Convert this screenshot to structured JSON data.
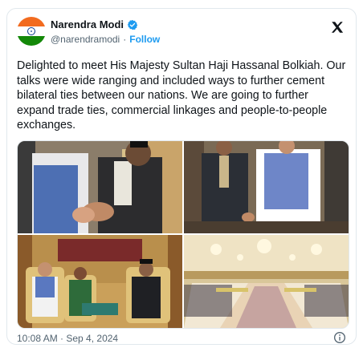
{
  "author": {
    "name": "Narendra Modi",
    "handle": "@narendramodi",
    "follow_label": "Follow"
  },
  "tweet": {
    "text": "Delighted to meet His Majesty Sultan Haji Hassanal Bolkiah. Our talks were wide ranging and included ways to further cement bilateral ties between our nations. We are going to further expand trade ties, commercial linkages and people-to-people exchanges.",
    "timestamp": "10:08 AM · Sep 4, 2024"
  },
  "media": {
    "count": 4
  },
  "icons": {
    "verified": "verified-badge-icon",
    "platform": "x-logo-icon",
    "info": "info-icon"
  },
  "colors": {
    "accent": "#1d9bf0",
    "text": "#0f1419",
    "muted": "#536471"
  }
}
